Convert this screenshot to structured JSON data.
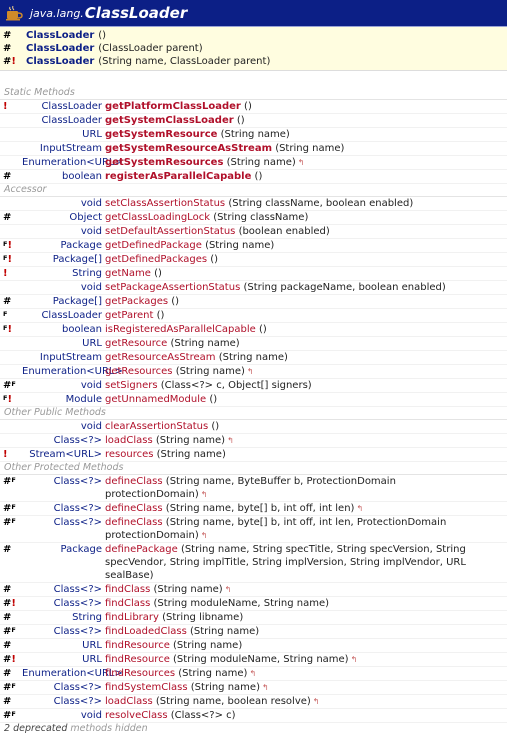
{
  "header": {
    "package": "java.lang.",
    "class_name": "ClassLoader"
  },
  "constructors": [
    {
      "marker": "#",
      "excl": "",
      "name": "ClassLoader",
      "params": "()"
    },
    {
      "marker": "#",
      "excl": "",
      "name": "ClassLoader",
      "params": "(ClassLoader parent)"
    },
    {
      "marker": "#",
      "excl": "!",
      "name": "ClassLoader",
      "params": "(String name, ClassLoader parent)"
    }
  ],
  "sections": [
    {
      "title": "Static Methods",
      "rows": [
        {
          "m1": "!",
          "m2": "",
          "sup": "",
          "ret": "ClassLoader",
          "name": "getPlatformClassLoader",
          "static": true,
          "params": "()",
          "gen": ""
        },
        {
          "m1": "",
          "m2": "",
          "sup": "",
          "ret": "ClassLoader",
          "name": "getSystemClassLoader",
          "static": true,
          "params": "()",
          "gen": ""
        },
        {
          "m1": "",
          "m2": "",
          "sup": "",
          "ret": "URL",
          "name": "getSystemResource",
          "static": true,
          "params": "(String name)",
          "gen": ""
        },
        {
          "m1": "",
          "m2": "",
          "sup": "",
          "ret": "InputStream",
          "name": "getSystemResourceAsStream",
          "static": true,
          "params": "(String name)",
          "gen": ""
        },
        {
          "m1": "",
          "m2": "",
          "sup": "",
          "ret": "Enumeration<URL>",
          "name": "getSystemResources",
          "static": true,
          "params": "(String name)",
          "gen": "↰"
        },
        {
          "m1": "#",
          "m2": "",
          "sup": "",
          "ret": "boolean",
          "name": "registerAsParallelCapable",
          "static": true,
          "params": "()",
          "gen": ""
        }
      ]
    },
    {
      "title": "Accessor",
      "rows": [
        {
          "m1": "",
          "m2": "",
          "sup": "",
          "ret": "void",
          "name": "setClassAssertionStatus",
          "static": false,
          "params": "(String className, boolean enabled)",
          "gen": ""
        },
        {
          "m1": "#",
          "m2": "",
          "sup": "",
          "ret": "Object",
          "name": "getClassLoadingLock",
          "static": false,
          "params": "(String className)",
          "gen": ""
        },
        {
          "m1": "",
          "m2": "",
          "sup": "",
          "ret": "void",
          "name": "setDefaultAssertionStatus",
          "static": false,
          "params": "(boolean enabled)",
          "gen": ""
        },
        {
          "m1": "",
          "m2": "!",
          "sup": "F",
          "ret": "Package",
          "name": "getDefinedPackage",
          "static": false,
          "params": "(String name)",
          "gen": ""
        },
        {
          "m1": "",
          "m2": "!",
          "sup": "F",
          "ret": "Package[]",
          "name": "getDefinedPackages",
          "static": false,
          "params": "()",
          "gen": ""
        },
        {
          "m1": "!",
          "m2": "",
          "sup": "",
          "ret": "String",
          "name": "getName",
          "static": false,
          "params": "()",
          "gen": ""
        },
        {
          "m1": "",
          "m2": "",
          "sup": "",
          "ret": "void",
          "name": "setPackageAssertionStatus",
          "static": false,
          "params": "(String packageName, boolean enabled)",
          "gen": ""
        },
        {
          "m1": "#",
          "m2": "",
          "sup": "",
          "ret": "Package[]",
          "name": "getPackages",
          "static": false,
          "params": "()",
          "gen": ""
        },
        {
          "m1": "",
          "m2": "",
          "sup": "F",
          "ret": "ClassLoader",
          "name": "getParent",
          "static": false,
          "params": "()",
          "gen": ""
        },
        {
          "m1": "",
          "m2": "!",
          "sup": "F",
          "ret": "boolean",
          "name": "isRegisteredAsParallelCapable",
          "static": false,
          "params": "()",
          "gen": ""
        },
        {
          "m1": "",
          "m2": "",
          "sup": "",
          "ret": "URL",
          "name": "getResource",
          "static": false,
          "params": "(String name)",
          "gen": ""
        },
        {
          "m1": "",
          "m2": "",
          "sup": "",
          "ret": "InputStream",
          "name": "getResourceAsStream",
          "static": false,
          "params": "(String name)",
          "gen": ""
        },
        {
          "m1": "",
          "m2": "",
          "sup": "",
          "ret": "Enumeration<URL>",
          "name": "getResources",
          "static": false,
          "params": "(String name)",
          "gen": "↰"
        },
        {
          "m1": "#",
          "m2": "",
          "sup": "F",
          "ret": "void",
          "name": "setSigners",
          "static": false,
          "params": "(Class<?> c, Object[] signers)",
          "gen": ""
        },
        {
          "m1": "",
          "m2": "!",
          "sup": "F",
          "ret": "Module",
          "name": "getUnnamedModule",
          "static": false,
          "params": "()",
          "gen": ""
        }
      ]
    },
    {
      "title": "Other Public Methods",
      "rows": [
        {
          "m1": "",
          "m2": "",
          "sup": "",
          "ret": "void",
          "name": "clearAssertionStatus",
          "static": false,
          "params": "()",
          "gen": ""
        },
        {
          "m1": "",
          "m2": "",
          "sup": "",
          "ret": "Class<?>",
          "name": "loadClass",
          "static": false,
          "params": "(String name)",
          "gen": "↰"
        },
        {
          "m1": "!",
          "m2": "",
          "sup": "",
          "ret": "Stream<URL>",
          "name": "resources",
          "static": false,
          "params": "(String name)",
          "gen": ""
        }
      ]
    },
    {
      "title": "Other Protected Methods",
      "rows": [
        {
          "m1": "#",
          "m2": "",
          "sup": "F",
          "ret": "Class<?>",
          "name": "defineClass",
          "static": false,
          "params": "(String name, ByteBuffer b, ProtectionDomain protectionDomain)",
          "gen": "↰"
        },
        {
          "m1": "#",
          "m2": "",
          "sup": "F",
          "ret": "Class<?>",
          "name": "defineClass",
          "static": false,
          "params": "(String name, byte[] b, int off, int len)",
          "gen": "↰"
        },
        {
          "m1": "#",
          "m2": "",
          "sup": "F",
          "ret": "Class<?>",
          "name": "defineClass",
          "static": false,
          "params": "(String name, byte[] b, int off, int len, ProtectionDomain protectionDomain)",
          "gen": "↰"
        },
        {
          "m1": "#",
          "m2": "",
          "sup": "",
          "ret": "Package",
          "name": "definePackage",
          "static": false,
          "params": "(String name, String specTitle, String specVersion, String specVendor, String implTitle, String implVersion, String implVendor, URL sealBase)",
          "gen": "",
          "wrap": true
        },
        {
          "m1": "#",
          "m2": "",
          "sup": "",
          "ret": "Class<?>",
          "name": "findClass",
          "static": false,
          "params": "(String name)",
          "gen": "↰"
        },
        {
          "m1": "#",
          "m2": "!",
          "sup": "",
          "ret": "Class<?>",
          "name": "findClass",
          "static": false,
          "params": "(String moduleName, String name)",
          "gen": ""
        },
        {
          "m1": "#",
          "m2": "",
          "sup": "",
          "ret": "String",
          "name": "findLibrary",
          "static": false,
          "params": "(String libname)",
          "gen": ""
        },
        {
          "m1": "#",
          "m2": "",
          "sup": "F",
          "ret": "Class<?>",
          "name": "findLoadedClass",
          "static": false,
          "params": "(String name)",
          "gen": ""
        },
        {
          "m1": "#",
          "m2": "",
          "sup": "",
          "ret": "URL",
          "name": "findResource",
          "static": false,
          "params": "(String name)",
          "gen": ""
        },
        {
          "m1": "#",
          "m2": "!",
          "sup": "",
          "ret": "URL",
          "name": "findResource",
          "static": false,
          "params": "(String moduleName, String name)",
          "gen": "↰"
        },
        {
          "m1": "#",
          "m2": "",
          "sup": "",
          "ret": "Enumeration<URL>",
          "name": "findResources",
          "static": false,
          "params": "(String name)",
          "gen": "↰"
        },
        {
          "m1": "#",
          "m2": "",
          "sup": "F",
          "ret": "Class<?>",
          "name": "findSystemClass",
          "static": false,
          "params": "(String name)",
          "gen": "↰"
        },
        {
          "m1": "#",
          "m2": "",
          "sup": "",
          "ret": "Class<?>",
          "name": "loadClass",
          "static": false,
          "params": "(String name, boolean resolve)",
          "gen": "↰"
        },
        {
          "m1": "#",
          "m2": "",
          "sup": "F",
          "ret": "void",
          "name": "resolveClass",
          "static": false,
          "params": "(Class<?> c)",
          "gen": ""
        }
      ]
    }
  ],
  "footer": {
    "count": "2 deprecated",
    "text": " methods hidden"
  },
  "colors": {
    "header_bg": "#0c1f86",
    "method_name": "#b0102a",
    "type": "#0c1f86",
    "ctor_bg": "#fffde0"
  }
}
